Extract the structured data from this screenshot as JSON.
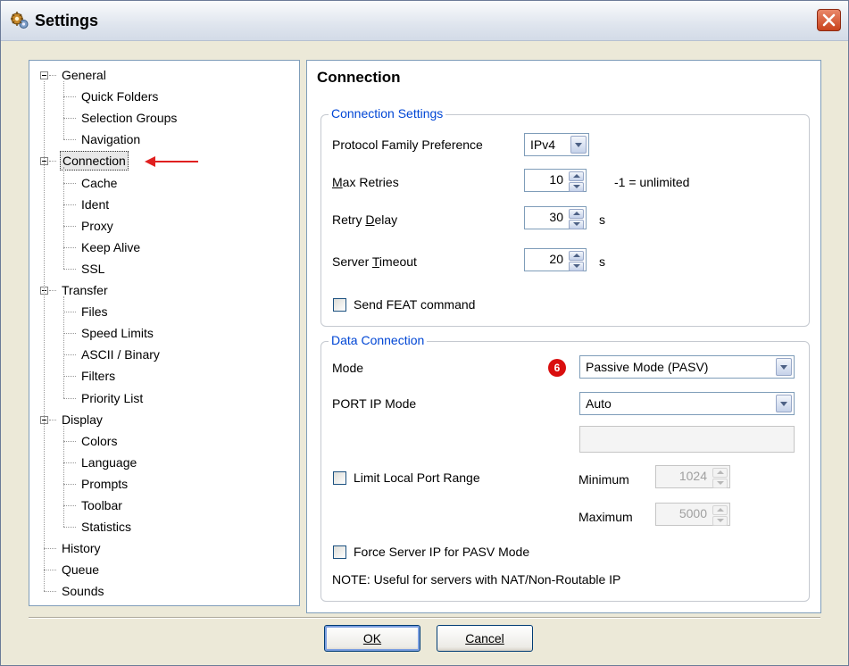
{
  "window": {
    "title": "Settings"
  },
  "tree": {
    "items": [
      {
        "label": "General",
        "level": 0,
        "expanded": true
      },
      {
        "label": "Quick Folders",
        "level": 1
      },
      {
        "label": "Selection Groups",
        "level": 1
      },
      {
        "label": "Navigation",
        "level": 1
      },
      {
        "label": "Connection",
        "level": 0,
        "expanded": true,
        "selected": true
      },
      {
        "label": "Cache",
        "level": 1
      },
      {
        "label": "Ident",
        "level": 1
      },
      {
        "label": "Proxy",
        "level": 1
      },
      {
        "label": "Keep Alive",
        "level": 1
      },
      {
        "label": "SSL",
        "level": 1
      },
      {
        "label": "Transfer",
        "level": 0,
        "expanded": true
      },
      {
        "label": "Files",
        "level": 1
      },
      {
        "label": "Speed Limits",
        "level": 1
      },
      {
        "label": "ASCII / Binary",
        "level": 1
      },
      {
        "label": "Filters",
        "level": 1
      },
      {
        "label": "Priority List",
        "level": 1
      },
      {
        "label": "Display",
        "level": 0,
        "expanded": true
      },
      {
        "label": "Colors",
        "level": 1
      },
      {
        "label": "Language",
        "level": 1
      },
      {
        "label": "Prompts",
        "level": 1
      },
      {
        "label": "Toolbar",
        "level": 1
      },
      {
        "label": "Statistics",
        "level": 1
      },
      {
        "label": "History",
        "level": 0
      },
      {
        "label": "Queue",
        "level": 0
      },
      {
        "label": "Sounds",
        "level": 0
      }
    ]
  },
  "panel": {
    "title": "Connection",
    "connection_settings": {
      "legend": "Connection Settings",
      "protocol_label": "Protocol Family Preference",
      "protocol_value": "IPv4",
      "max_retries_label": "Max Retries",
      "max_retries_value": "10",
      "max_retries_hint": "-1 = unlimited",
      "retry_delay_label": "Retry Delay",
      "retry_delay_value": "30",
      "retry_delay_unit": "s",
      "server_timeout_label": "Server Timeout",
      "server_timeout_value": "20",
      "server_timeout_unit": "s",
      "send_feat_label": "Send FEAT command"
    },
    "data_connection": {
      "legend": "Data Connection",
      "mode_label": "Mode",
      "mode_badge": "6",
      "mode_value": "Passive Mode (PASV)",
      "port_ip_label": "PORT IP Mode",
      "port_ip_value": "Auto",
      "limit_port_label": "Limit Local Port Range",
      "minimum_label": "Minimum",
      "minimum_value": "1024",
      "maximum_label": "Maximum",
      "maximum_value": "5000",
      "force_ip_label": "Force Server IP for PASV Mode",
      "note": "NOTE: Useful for servers with NAT/Non-Routable IP"
    }
  },
  "buttons": {
    "ok": "OK",
    "cancel": "Cancel"
  },
  "colors": {
    "accent": "#0046d5",
    "badge": "#d90e0e",
    "annotation_arrow": "#e02020"
  }
}
